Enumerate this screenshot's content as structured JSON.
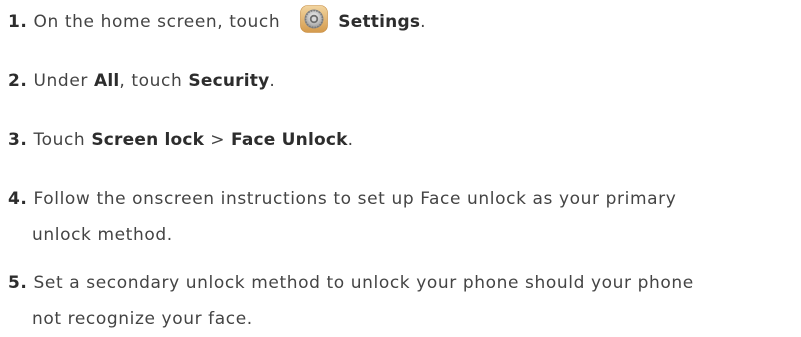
{
  "steps": [
    {
      "number": "1.",
      "text_before": "On the home screen, touch",
      "bold": "Settings",
      "text_after": "."
    },
    {
      "number": "2.",
      "text_before": "Under ",
      "bold_a": "All",
      "text_mid": ", touch ",
      "bold_b": "Security",
      "text_after": "."
    },
    {
      "number": "3.",
      "text_before": "Touch ",
      "bold_a": "Screen lock",
      "text_mid": " > ",
      "bold_b": "Face Unlock",
      "text_after": "."
    },
    {
      "number": "4.",
      "line1": "Follow the onscreen instructions to set up Face unlock as your primary",
      "line2": "unlock method."
    },
    {
      "number": "5.",
      "line1": "Set a secondary unlock method to unlock your phone should your phone",
      "line2": "not recognize your face."
    }
  ],
  "icons": {
    "settings": "settings-gear-icon"
  }
}
